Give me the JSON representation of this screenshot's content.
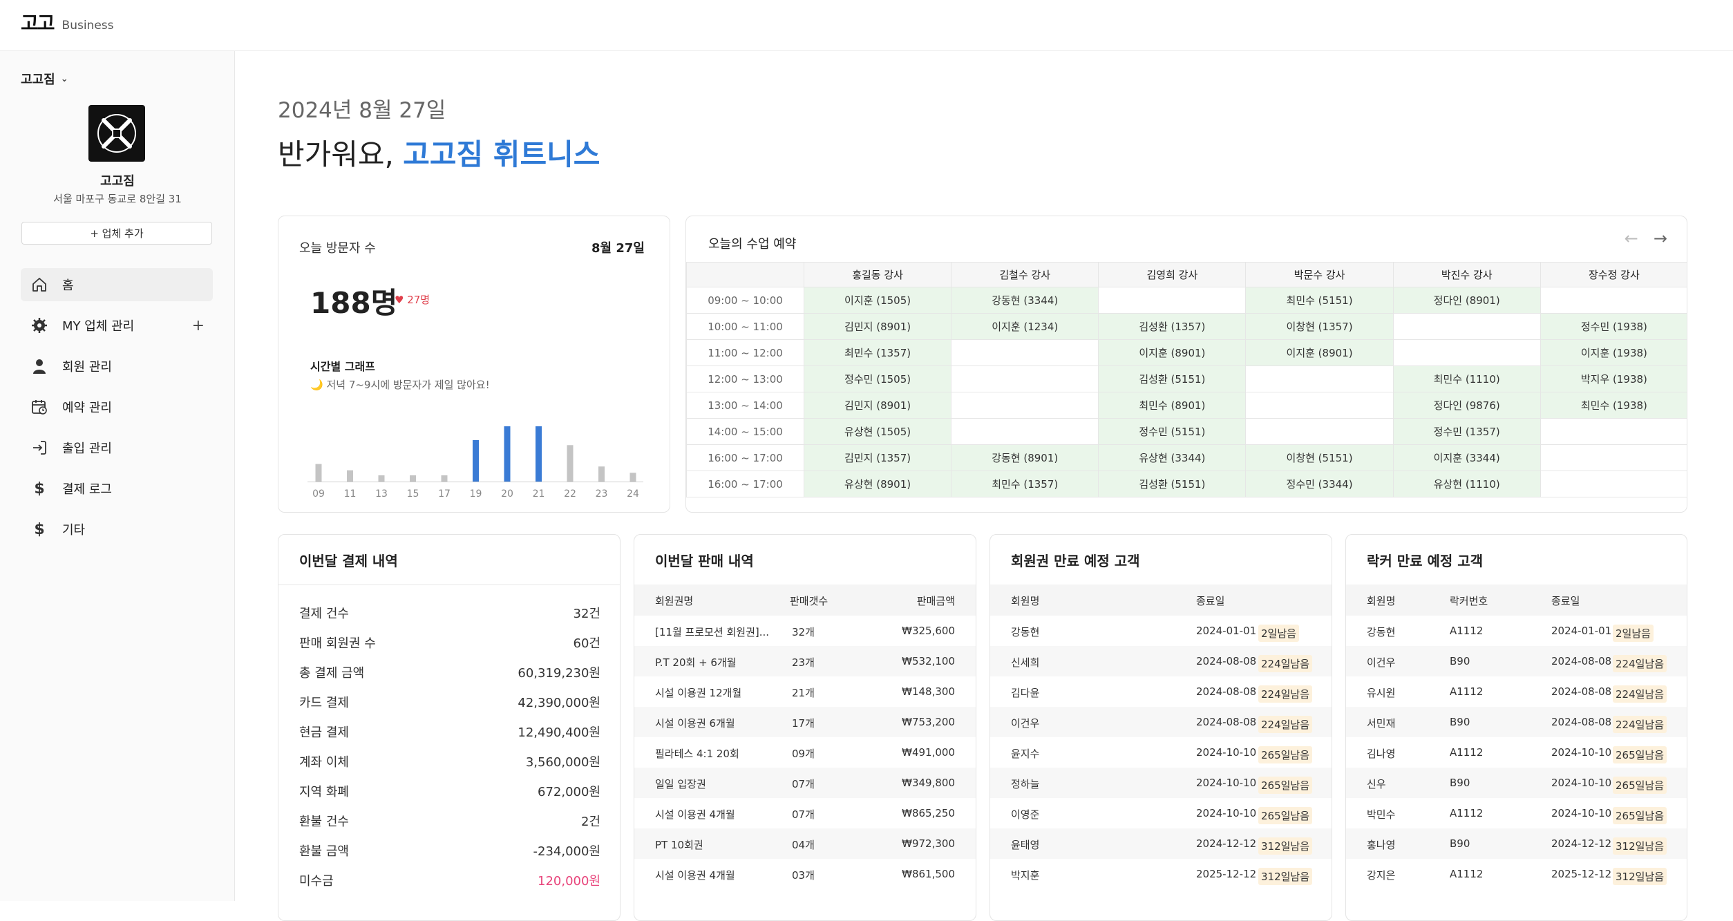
{
  "brand": {
    "logo": "고고",
    "suffix": "Business"
  },
  "sidebar": {
    "gym_select": "고고짐",
    "gym_name": "고고짐",
    "gym_address": "서울 마포구 동교로 8안길 31",
    "add_business": "+ 업체 추가",
    "items": [
      {
        "label": "홈",
        "icon": "home-icon"
      },
      {
        "label": "MY 업체 관리",
        "icon": "gear-icon"
      },
      {
        "label": "회원 관리",
        "icon": "person-icon"
      },
      {
        "label": "예약 관리",
        "icon": "calendar-icon"
      },
      {
        "label": "출입 관리",
        "icon": "enter-icon"
      },
      {
        "label": "결제 로그",
        "icon": "dollar-icon"
      },
      {
        "label": "기타",
        "icon": "dollar-icon"
      }
    ],
    "add_symbol": "+"
  },
  "greeting": {
    "date": "2024년 8월 27일",
    "prefix": "반가워요, ",
    "name": "고고짐 휘트니스"
  },
  "visitors": {
    "title": "오늘 방문자 수",
    "date": "8월 27일",
    "count": "188명",
    "delta": "27명",
    "graph_title": "시간별 그래프",
    "graph_sub": "🌙 저녁 7~9시에 방문자가 제일 많아요!",
    "chart_data": {
      "type": "bar",
      "categories": [
        "09",
        "11",
        "13",
        "15",
        "17",
        "19",
        "20",
        "21",
        "22",
        "23",
        "24"
      ],
      "values": [
        14,
        9,
        5,
        5,
        5,
        33,
        44,
        44,
        29,
        12,
        7
      ],
      "highlight": [
        "19",
        "20",
        "21"
      ],
      "colors": {
        "normal": "#c4c4c4",
        "highlight": "#3a7bd5"
      }
    }
  },
  "classes": {
    "title": "오늘의 수업 예약",
    "instructors": [
      "홍길동 강사",
      "김철수 강사",
      "김영희 강사",
      "박문수 강사",
      "박진수 강사",
      "장수정 강사"
    ],
    "rows": [
      {
        "time": "09:00 ~ 10:00",
        "cells": [
          "이지훈 (1505)",
          "강동현 (3344)",
          "",
          "최민수 (5151)",
          "정다인 (8901)",
          ""
        ]
      },
      {
        "time": "10:00 ~ 11:00",
        "cells": [
          "김민지 (8901)",
          "이지훈 (1234)",
          "김성환 (1357)",
          "이창현 (1357)",
          "",
          "정수민 (1938)"
        ]
      },
      {
        "time": "11:00 ~ 12:00",
        "cells": [
          "최민수 (1357)",
          "",
          "이지훈 (8901)",
          "이지훈 (8901)",
          "",
          "이지훈 (1938)"
        ]
      },
      {
        "time": "12:00 ~ 13:00",
        "cells": [
          "정수민 (1505)",
          "",
          "김성환 (5151)",
          "",
          "최민수 (1110)",
          "박지우 (1938)"
        ]
      },
      {
        "time": "13:00 ~ 14:00",
        "cells": [
          "김민지 (8901)",
          "",
          "최민수 (8901)",
          "",
          "정다인 (9876)",
          "최민수 (1938)"
        ]
      },
      {
        "time": "14:00 ~ 15:00",
        "cells": [
          "유상현 (1505)",
          "",
          "정수민 (5151)",
          "",
          "정수민 (1357)",
          ""
        ]
      },
      {
        "time": "16:00 ~ 17:00",
        "cells": [
          "김민지 (1357)",
          "강동현 (8901)",
          "유상현 (3344)",
          "이창현 (5151)",
          "이지훈 (3344)",
          ""
        ]
      },
      {
        "time": "16:00 ~ 17:00",
        "cells": [
          "유상현 (8901)",
          "최민수 (1357)",
          "김성환 (5151)",
          "정수민 (3344)",
          "유상현 (1110)",
          ""
        ]
      }
    ]
  },
  "payments": {
    "title": "이번달 결제 내역",
    "rows": [
      {
        "label": "결제 건수",
        "value": "32건"
      },
      {
        "label": "판매 회원권 수",
        "value": "60건"
      },
      {
        "label": "총 결제 금액",
        "value": "60,319,230원"
      },
      {
        "label": "카드 결제",
        "value": "42,390,000원"
      },
      {
        "label": "현금 결제",
        "value": "12,490,400원"
      },
      {
        "label": "계좌 이체",
        "value": "3,560,000원"
      },
      {
        "label": "지역 화폐",
        "value": "672,000원"
      },
      {
        "label": "환불 건수",
        "value": "2건"
      },
      {
        "label": "환불 금액",
        "value": "-234,000원"
      },
      {
        "label": "미수금",
        "value": "120,000원"
      }
    ]
  },
  "sales": {
    "title": "이번달 판매 내역",
    "headers": [
      "회원권명",
      "판매갯수",
      "판매금액"
    ],
    "rows": [
      [
        "[11월 프로모션 회원권]...",
        "32개",
        "₩325,600"
      ],
      [
        "P.T 20회 + 6개월",
        "23개",
        "₩532,100"
      ],
      [
        "시설 이용권 12개월",
        "21개",
        "₩148,300"
      ],
      [
        "시설 이용권 6개월",
        "17개",
        "₩753,200"
      ],
      [
        "필라테스 4:1 20회",
        "09개",
        "₩491,000"
      ],
      [
        "일일 입장권",
        "07개",
        "₩349,800"
      ],
      [
        "시설 이용권 4개월",
        "07개",
        "₩865,250"
      ],
      [
        "PT 10회권",
        "04개",
        "₩972,300"
      ],
      [
        "시설 이용권 4개월",
        "03개",
        "₩861,500"
      ]
    ]
  },
  "expiry": {
    "title": "회원권 만료 예정 고객",
    "headers": [
      "회원명",
      "종료일"
    ],
    "rows": [
      [
        "강동현",
        "2024-01-01",
        "2일남음"
      ],
      [
        "신세희",
        "2024-08-08",
        "224일남음"
      ],
      [
        "김다윤",
        "2024-08-08",
        "224일남음"
      ],
      [
        "이건우",
        "2024-08-08",
        "224일남음"
      ],
      [
        "윤지수",
        "2024-10-10",
        "265일남음"
      ],
      [
        "정하늘",
        "2024-10-10",
        "265일남음"
      ],
      [
        "이영준",
        "2024-10-10",
        "265일남음"
      ],
      [
        "윤태영",
        "2024-12-12",
        "312일남음"
      ],
      [
        "박지훈",
        "2025-12-12",
        "312일남음"
      ]
    ]
  },
  "locker": {
    "title": "락커 만료 예정 고객",
    "headers": [
      "회원명",
      "락커번호",
      "종료일"
    ],
    "rows": [
      [
        "강동현",
        "A1112",
        "2024-01-01",
        "2일남음"
      ],
      [
        "이건우",
        "B90",
        "2024-08-08",
        "224일남음"
      ],
      [
        "유시원",
        "A1112",
        "2024-08-08",
        "224일남음"
      ],
      [
        "서민재",
        "B90",
        "2024-08-08",
        "224일남음"
      ],
      [
        "김나영",
        "A1112",
        "2024-10-10",
        "265일남음"
      ],
      [
        "신우",
        "B90",
        "2024-10-10",
        "265일남음"
      ],
      [
        "박민수",
        "A1112",
        "2024-10-10",
        "265일남음"
      ],
      [
        "홍나영",
        "B90",
        "2024-12-12",
        "312일남음"
      ],
      [
        "강지은",
        "A1112",
        "2025-12-12",
        "312일남음"
      ]
    ]
  }
}
